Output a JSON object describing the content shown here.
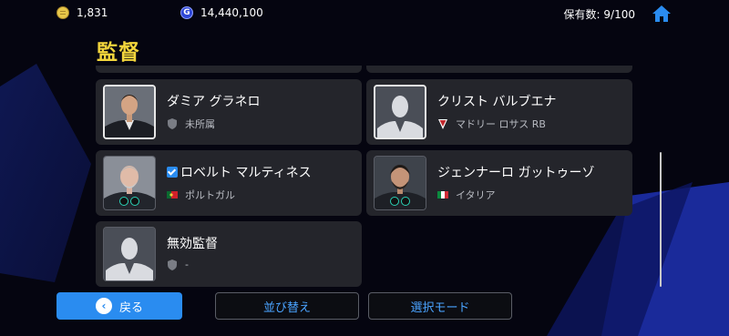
{
  "header": {
    "coins": "1,831",
    "gp": "14,440,100",
    "gp_icon_letter": "G",
    "capacity": "保有数: 9/100"
  },
  "page_title": "監督",
  "managers": [
    {
      "name": "ダミア グラネロ",
      "team": "未所属",
      "team_icon": "shield-icon",
      "selected": false
    },
    {
      "name": "クリスト バルブエナ",
      "team": "マドリー ロサス RB",
      "team_icon": "club-crest-icon",
      "selected": false
    },
    {
      "name": "ロベルト マルティネス",
      "team": "ポルトガル",
      "team_icon": "portugal-flag-icon",
      "selected": true
    },
    {
      "name": "ジェンナーロ ガットゥーゾ",
      "team": "イタリア",
      "team_icon": "italy-flag-icon",
      "selected": false
    },
    {
      "name": "無効監督",
      "team": "-",
      "team_icon": "shield-icon",
      "selected": false
    }
  ],
  "buttons": {
    "back": "戻る",
    "sort": "並び替え",
    "select_mode": "選択モード"
  },
  "colors": {
    "accent_blue": "#2a8cf0",
    "title_yellow": "#f2d53c",
    "card_bg": "#24252b"
  }
}
